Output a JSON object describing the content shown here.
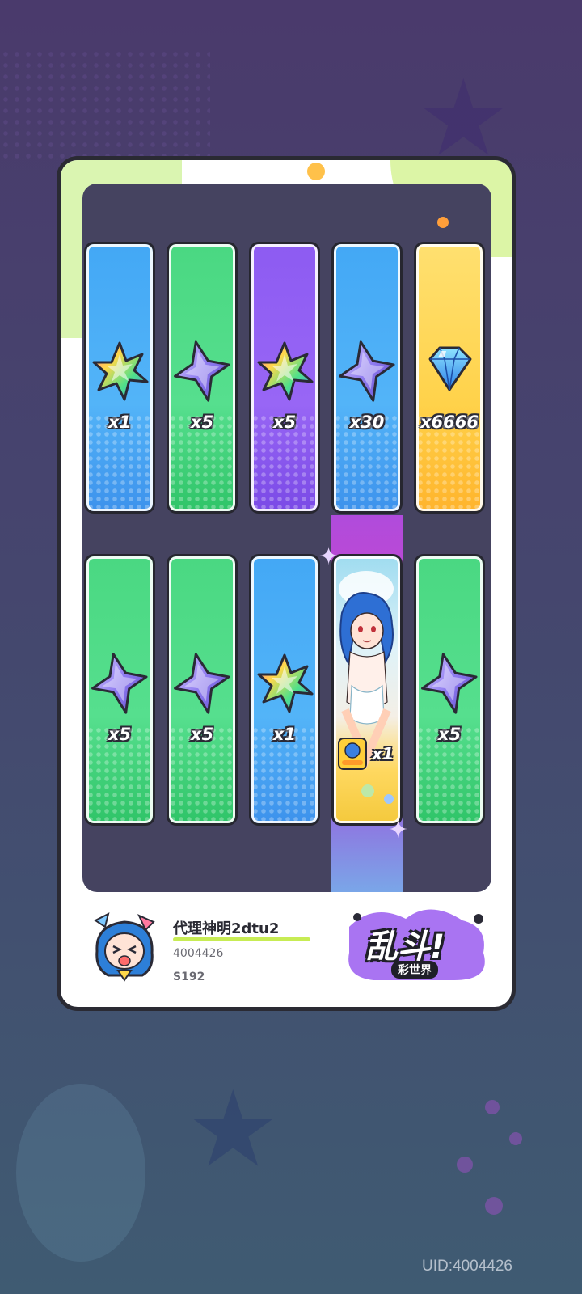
{
  "rewards_top": [
    {
      "quantity": "x1",
      "item": "rainbow-star-shard-icon",
      "color": "blue"
    },
    {
      "quantity": "x5",
      "item": "purple-star-shard-icon",
      "color": "green"
    },
    {
      "quantity": "x5",
      "item": "rainbow-star-shard-icon",
      "color": "purple"
    },
    {
      "quantity": "x30",
      "item": "purple-star-shard-icon",
      "color": "blue"
    },
    {
      "quantity": "x6666",
      "item": "blue-diamond-icon",
      "color": "yellow"
    }
  ],
  "rewards_bottom": [
    {
      "quantity": "x5",
      "item": "purple-star-shard-icon",
      "color": "green"
    },
    {
      "quantity": "x5",
      "item": "purple-star-shard-icon",
      "color": "green"
    },
    {
      "quantity": "x1",
      "item": "rainbow-star-shard-icon",
      "color": "blue"
    },
    {
      "quantity": "x1",
      "item": "character-card",
      "color": "rainbow"
    },
    {
      "quantity": "x5",
      "item": "purple-star-shard-icon",
      "color": "green"
    }
  ],
  "player": {
    "name": "代理神明2dtu2",
    "id": "4004426",
    "server": "S192"
  },
  "logo": {
    "title": "乱斗!",
    "subtitle": "彩世界"
  },
  "uid_label": "UID:4004426"
}
